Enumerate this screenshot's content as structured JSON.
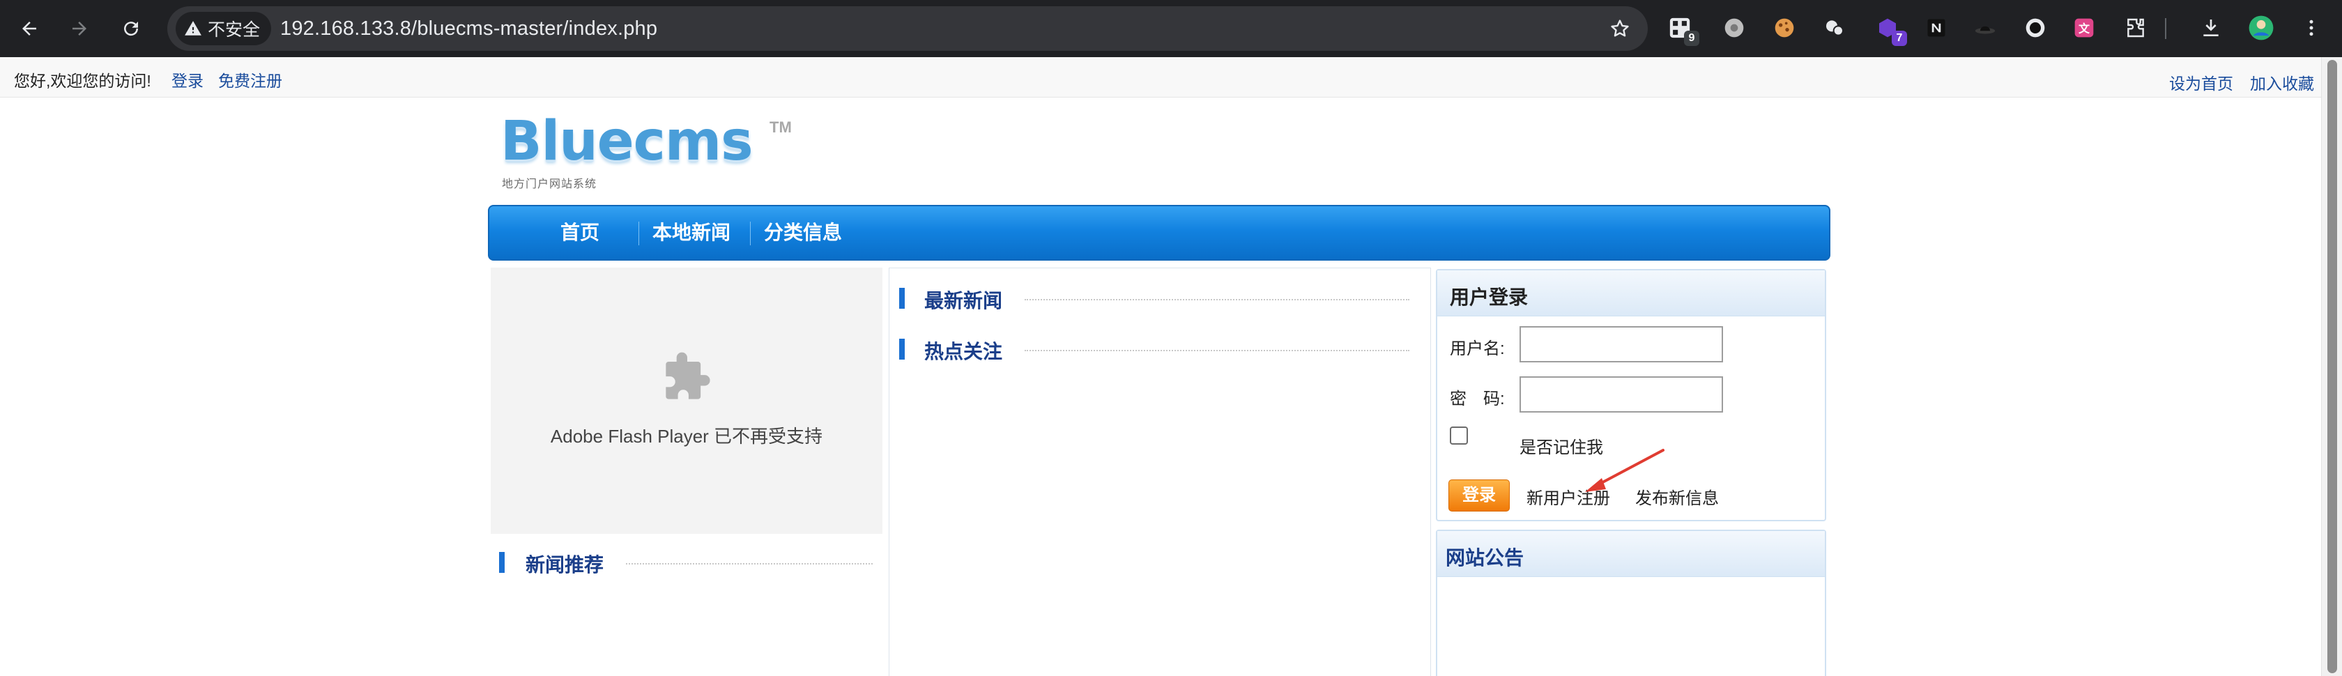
{
  "browser": {
    "security_label": "不安全",
    "url": "192.168.133.8/bluecms-master/index.php",
    "extensions": [
      {
        "name": "qr-extension-icon",
        "badge": "9",
        "badge_color": "#3c4043"
      },
      {
        "name": "settings-extension-icon",
        "badge": ""
      },
      {
        "name": "cookie-extension-icon",
        "badge": ""
      },
      {
        "name": "chat-extension-icon",
        "badge": ""
      },
      {
        "name": "hex-extension-icon",
        "badge": "7",
        "badge_color": "#6f3fd1"
      },
      {
        "name": "n-extension-icon",
        "badge": ""
      },
      {
        "name": "hat-extension-icon",
        "badge": ""
      },
      {
        "name": "record-extension-icon",
        "badge": ""
      },
      {
        "name": "translate-extension-icon",
        "badge": ""
      },
      {
        "name": "puzzle-extensions-icon",
        "badge": ""
      },
      {
        "name": "download-icon",
        "badge": ""
      },
      {
        "name": "profile-avatar",
        "badge": ""
      },
      {
        "name": "menu-kebab-icon",
        "badge": ""
      }
    ]
  },
  "topbar": {
    "greeting": "您好,欢迎您的访问!",
    "login": "登录",
    "register": "免费注册",
    "set_home": "设为首页",
    "bookmark": "加入收藏"
  },
  "logo": {
    "text": "Bluecms",
    "tm": "TM",
    "subtitle": "地方门户网站系统"
  },
  "nav": {
    "home": "首页",
    "local_news": "本地新闻",
    "classified": "分类信息"
  },
  "flash": {
    "message": "Adobe Flash Player 已不再受支持"
  },
  "sections": {
    "recommended": "新闻推荐",
    "latest": "最新新闻",
    "hot": "热点关注"
  },
  "login_panel": {
    "title": "用户登录",
    "username_label": "用户名:",
    "password_label": "密　码:",
    "username_value": "",
    "password_value": "",
    "remember_label": "是否记住我",
    "submit": "登录",
    "new_user": "新用户注册",
    "post_info": "发布新信息"
  },
  "notice_panel": {
    "title": "网站公告"
  },
  "colors": {
    "chrome_bg": "#202124",
    "nav_blue": "#1282e0",
    "section_title": "#1b3f8a",
    "button_orange": "#f07a08",
    "annotation_red": "#e03c31"
  }
}
